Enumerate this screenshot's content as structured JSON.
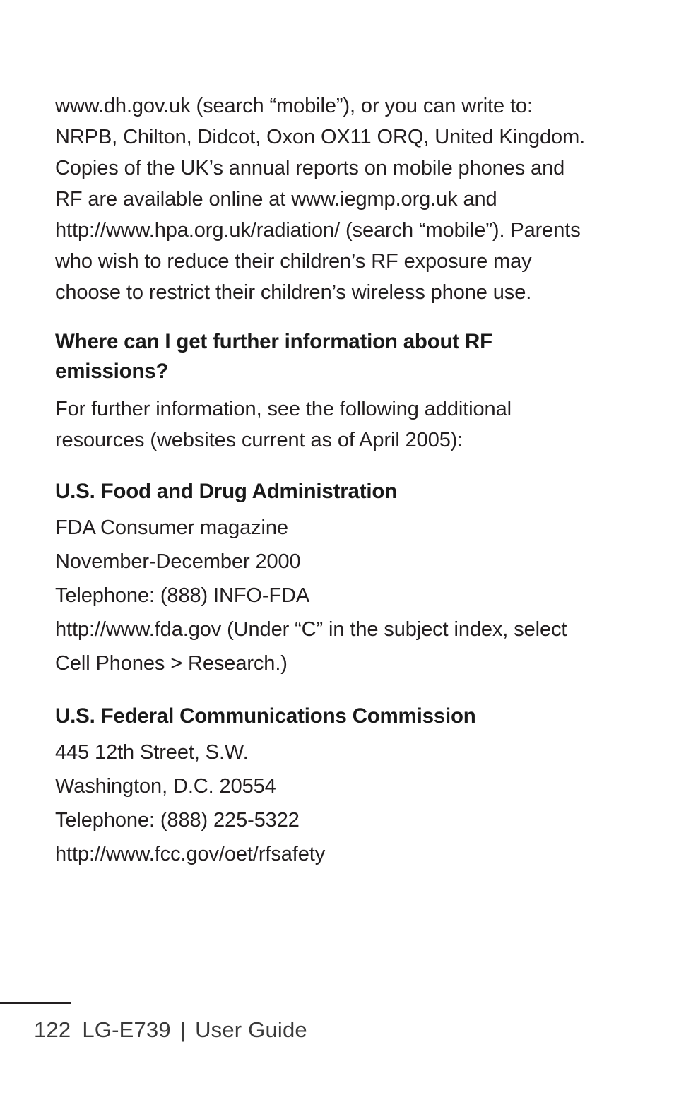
{
  "document": {
    "page_number": "122",
    "footer": {
      "page_label": "122",
      "model": "LG-E739",
      "separator": "|",
      "doc_title": "User Guide"
    }
  },
  "content": {
    "intro_paragraph": "www.dh.gov.uk (search “mobile”), or you can write to: NRPB, Chilton, Didcot, Oxon OX11 ORQ, United Kingdom. Copies of the UK’s annual reports on mobile phones and RF are available online at www.iegmp.org.uk and http://www.hpa.org.uk/radiation/ (search “mobile”). Parents who wish to reduce their children’s RF exposure may choose to restrict their children’s wireless phone use.",
    "rf_question_heading": "Where can I get further information about RF emissions?",
    "rf_question_body": "For further information, see the following additional resources (websites current as of April 2005):",
    "fda": {
      "heading": "U.S. Food and Drug Administration",
      "lines": [
        "FDA Consumer magazine",
        "November-December 2000",
        "Telephone: (888) INFO-FDA"
      ],
      "note": "http://www.fda.gov (Under “C” in the subject index, select Cell Phones > Research.)"
    },
    "fcc": {
      "heading": "U.S. Federal Communications Commission",
      "lines": [
        "445 12th Street, S.W.",
        "Washington, D.C. 20554",
        "Telephone: (888) 225-5322",
        "http://www.fcc.gov/oet/rfsafety"
      ]
    }
  },
  "colors": {
    "text": "#231f20",
    "heading": "#1a1a1a",
    "background": "#ffffff",
    "rule": "#231f20"
  }
}
